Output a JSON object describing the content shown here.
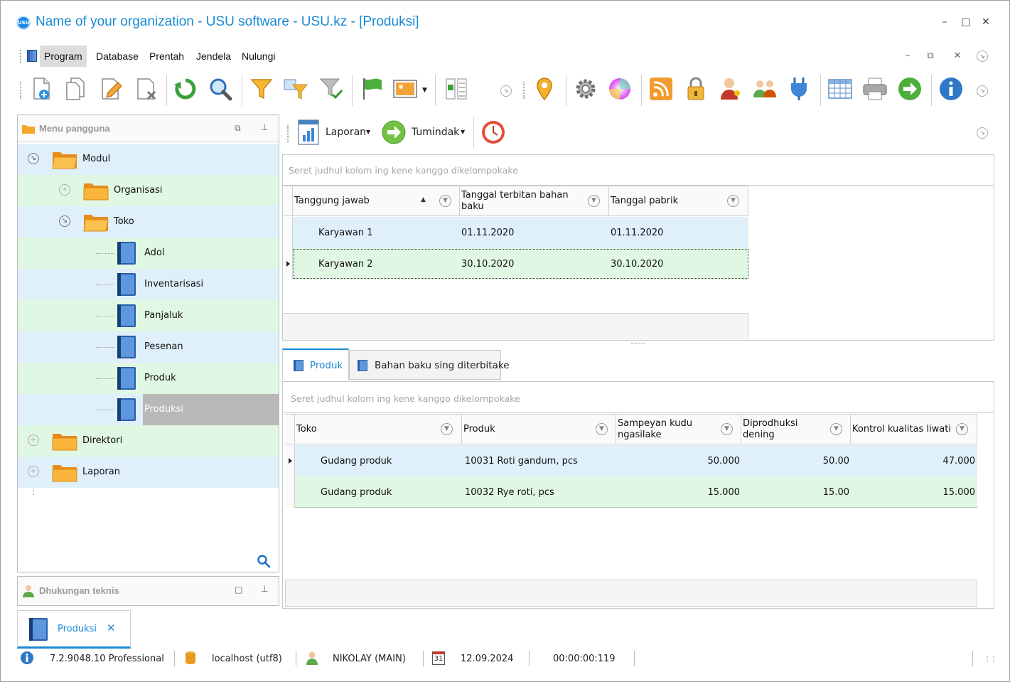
{
  "window": {
    "title": "Name of your organization - USU software - USU.kz - [Produksi]",
    "logo_text": "USU"
  },
  "menu": {
    "items": [
      "Program",
      "Database",
      "Prentah",
      "Jendela",
      "Nulungi"
    ]
  },
  "toolbar": {
    "icons": [
      "new-document-icon",
      "copy-icon",
      "edit-icon",
      "delete-icon",
      "refresh-icon",
      "search-icon",
      "filter-icon",
      "filter-column-icon",
      "filter-clear-icon",
      "flag-icon",
      "image-icon",
      "list-add-icon",
      "map-pin-icon",
      "settings-gear-icon",
      "color-wheel-icon",
      "rss-icon",
      "lock-icon",
      "user-key-icon",
      "users-icon",
      "plug-icon",
      "table-icon",
      "printer-icon",
      "exit-arrow-icon",
      "info-icon"
    ]
  },
  "sidebar": {
    "title": "Menu pangguna",
    "tree": [
      {
        "label": "Modul"
      },
      {
        "label": "Organisasi"
      },
      {
        "label": "Toko"
      },
      {
        "label": "Adol"
      },
      {
        "label": "Inventarisasi"
      },
      {
        "label": "Panjaluk"
      },
      {
        "label": "Pesenan"
      },
      {
        "label": "Produk"
      },
      {
        "label": "Produksi"
      },
      {
        "label": "Direktori"
      },
      {
        "label": "Laporan"
      }
    ],
    "support_title": "Dhukungan teknis"
  },
  "main_toolbar": {
    "report_label": "Laporan",
    "action_label": "Tumindak"
  },
  "grid1": {
    "group_hint": "Seret judhul kolom ing kene kanggo dikelompokake",
    "columns": [
      "Tanggung jawab",
      "Tanggal terbitan bahan baku",
      "Tanggal pabrik"
    ],
    "rows": [
      [
        "Karyawan 1",
        "01.11.2020",
        "01.11.2020"
      ],
      [
        "Karyawan 2",
        "30.10.2020",
        "30.10.2020"
      ]
    ]
  },
  "tabs": [
    "Produk",
    "Bahan baku sing diterbitake"
  ],
  "grid2": {
    "group_hint": "Seret judhul kolom ing kene kanggo dikelompokake",
    "columns": [
      "Toko",
      "Produk",
      "Sampeyan kudu ngasilake",
      "Diprodhuksi dening",
      "Kontrol kualitas liwati"
    ],
    "rows": [
      [
        "Gudang produk",
        "10031 Roti gandum, pcs",
        "50.000",
        "50.00",
        "47.000"
      ],
      [
        "Gudang produk",
        "10032 Rye roti, pcs",
        "15.000",
        "15.00",
        "15.000"
      ]
    ]
  },
  "bottom_tab": {
    "label": "Produksi"
  },
  "status": {
    "version": "7.2.9048.10 Professional",
    "server": "localhost (utf8)",
    "user": "NIKOLAY (MAIN)",
    "calendar_day": "31",
    "date": "12.09.2024",
    "timer": "00:00:00:119"
  },
  "colors": {
    "accent": "#1a8ad4",
    "row_blue": "#dff0fb",
    "row_green": "#e0f7e3"
  }
}
